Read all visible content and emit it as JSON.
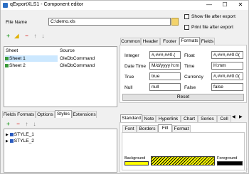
{
  "window": {
    "title": "qExportXLS1 - Component editor",
    "minimize": "—",
    "maximize": "☐",
    "close": "✕"
  },
  "file": {
    "label": "File Name",
    "value": "C:\\demo.xls",
    "show_after_export": "Show file after export",
    "print_after_export": "Print file after export"
  },
  "sheets": {
    "col_sheet": "Sheet",
    "col_source": "Source",
    "rows": [
      {
        "sheet": "Sheet 1",
        "source": "OleDbCommand"
      },
      {
        "sheet": "Sheet 2",
        "source": "OleDbCommand"
      }
    ]
  },
  "right_tabs": [
    "Common",
    "Header",
    "Footer",
    "Formats",
    "Fields"
  ],
  "formats": {
    "integer_label": "Integer",
    "integer_value": "#,###,##0.(",
    "float_label": "Float",
    "float_value": "#,###,##0.0(",
    "datetime_label": "Date Time",
    "datetime_value": "M/d/yyyy h:m",
    "time_label": "Time",
    "time_value": "H:mm",
    "true_label": "True",
    "true_value": "true",
    "currency_label": "Currency",
    "currency_value": "#,###,##0.0(",
    "null_label": "Null",
    "null_value": "null",
    "false_label": "False",
    "false_value": "false",
    "reset": "Reset"
  },
  "bottom_tabs": [
    "Fields Formats",
    "Options",
    "Styles",
    "Extensions"
  ],
  "styles": [
    "STYLE_1",
    "STYLE_2"
  ],
  "style_tabs": [
    "Standard",
    "Note",
    "Hyperlink",
    "Chart",
    "Series",
    "Cell"
  ],
  "style_subtabs": [
    "Font",
    "Borders",
    "Fill",
    "Format"
  ],
  "fill": {
    "background_label": "Background",
    "foreground_label": "Foreground",
    "background_color": "#ffff00",
    "foreground_color": "#000000"
  }
}
